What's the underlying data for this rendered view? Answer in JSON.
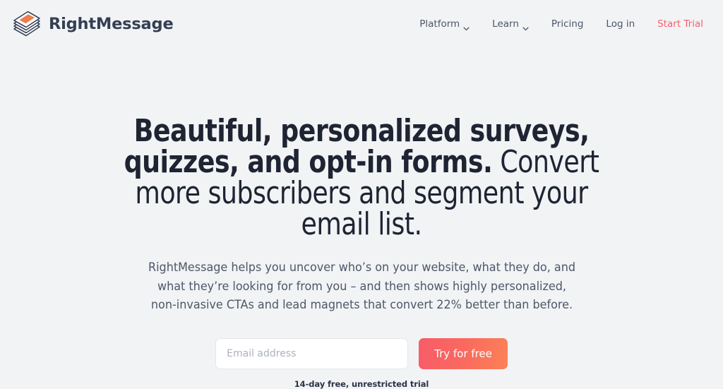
{
  "theme": {
    "page_background": "#f1f3f5",
    "heading_color": "#1f2433",
    "body_text_color": "#4d5769",
    "accent_color": "#f4616b",
    "cta_gradient_from": "#f85c68",
    "cta_gradient_to": "#fb8257",
    "logo_stripe_color": "#ef7c4e",
    "logo_outline_color": "#39445a"
  },
  "header": {
    "brand": {
      "name": "RightMessage",
      "logo_icon": "layered-cards-icon"
    },
    "nav": [
      {
        "label": "Platform",
        "has_dropdown": true,
        "icon": "chevron-down-icon",
        "accent": false
      },
      {
        "label": "Learn",
        "has_dropdown": true,
        "icon": "chevron-down-icon",
        "accent": false
      },
      {
        "label": "Pricing",
        "has_dropdown": false,
        "icon": "",
        "accent": false
      },
      {
        "label": "Log in",
        "has_dropdown": false,
        "icon": "",
        "accent": false
      },
      {
        "label": "Start Trial",
        "has_dropdown": false,
        "icon": "",
        "accent": true
      }
    ]
  },
  "hero": {
    "title_bold": "Beautiful, personalized surveys, quizzes, and opt-in forms.",
    "title_light": "Convert more subscribers and segment your email list.",
    "subtitle": "RightMessage helps you uncover who’s on your website, what they do, and what they’re looking for from you – and then shows highly personalized, non-invasive CTAs and lead magnets that convert 22% better than before.",
    "form": {
      "email_placeholder": "Email address",
      "email_value": "",
      "cta_label": "Try for free",
      "trial_note": "14-day free, unrestricted trial"
    }
  }
}
